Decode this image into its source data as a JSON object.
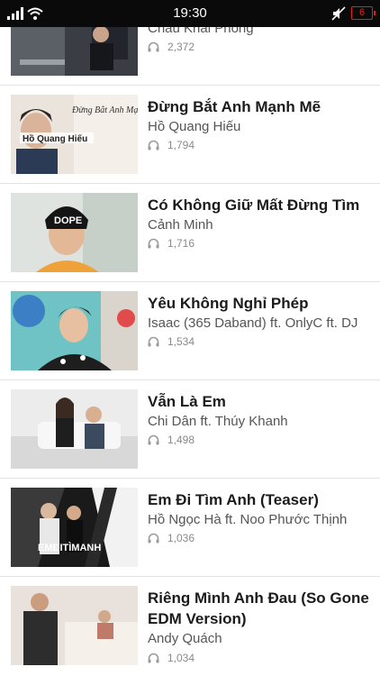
{
  "status_bar": {
    "time": "19:30",
    "signal_icon": "signal-icon",
    "wifi_icon": "wifi-icon",
    "mute_icon": "mute-icon",
    "battery_level": "6",
    "battery_color": "#e02020"
  },
  "songs": [
    {
      "title": "",
      "artist": "Châu Khải Phong",
      "plays": "2,372",
      "thumb_icon": "video-thumbnail"
    },
    {
      "title": "Đừng Bắt Anh Mạnh Mẽ",
      "artist": "Hồ Quang Hiếu",
      "plays": "1,794",
      "thumb_icon": "video-thumbnail"
    },
    {
      "title": "Có Không Giữ Mất Đừng Tìm",
      "artist": "Cảnh Minh",
      "plays": "1,716",
      "thumb_icon": "video-thumbnail"
    },
    {
      "title": "Yêu Không Nghỉ Phép",
      "artist": "Isaac (365 Daband) ft. OnlyC ft. DJ",
      "plays": "1,534",
      "thumb_icon": "video-thumbnail"
    },
    {
      "title": "Vẫn Là Em",
      "artist": "Chi Dân ft. Thúy Khanh",
      "plays": "1,498",
      "thumb_icon": "video-thumbnail"
    },
    {
      "title": "Em Đi Tìm Anh (Teaser)",
      "artist": "Hồ Ngọc Hà ft. Noo Phước Thịnh",
      "plays": "1,036",
      "thumb_icon": "video-thumbnail"
    },
    {
      "title": "Riêng Mình Anh Đau (So Gone EDM Version)",
      "artist": "Andy Quách",
      "plays": "1,034",
      "thumb_icon": "video-thumbnail"
    }
  ],
  "thumb_text": {
    "row1": "Đừng Bắt Anh Mạnh Mẽ",
    "row1_name": "Hồ Quang Hiếu",
    "row2_cap": "DOPE",
    "row5": "EMĐITÌMANH"
  },
  "colors": {
    "title": "#1b1b1b",
    "artist": "#555555",
    "count": "#8a8a8a",
    "divider": "#e3e3e3"
  }
}
